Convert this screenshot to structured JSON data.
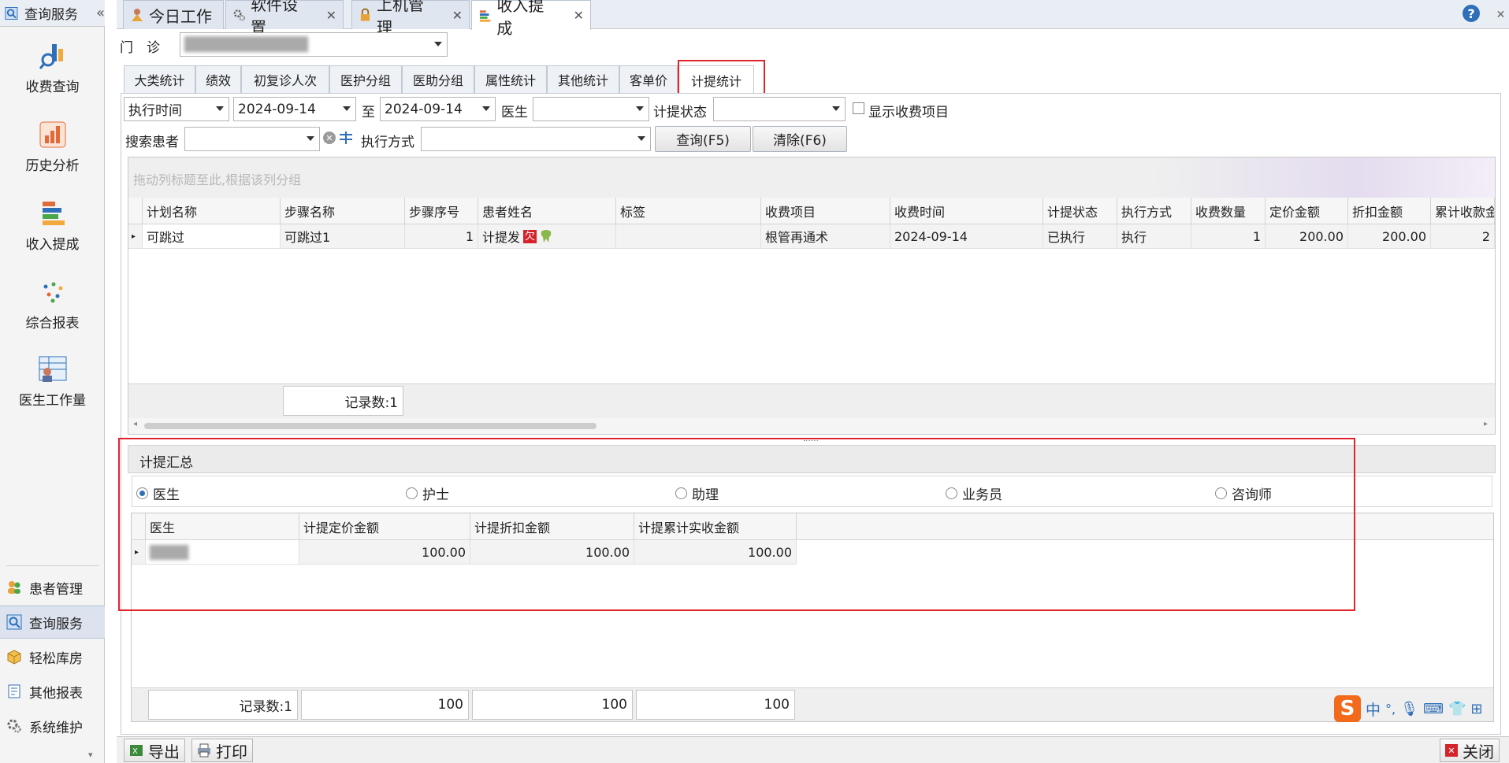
{
  "sidebar": {
    "header_title": "查询服务",
    "big_items": [
      {
        "label": "收费查询",
        "icon": "bar-search-icon"
      },
      {
        "label": "历史分析",
        "icon": "chart-icon"
      },
      {
        "label": "收入提成",
        "icon": "stacked-bars-icon"
      },
      {
        "label": "综合报表",
        "icon": "dots-icon"
      },
      {
        "label": "医生工作量",
        "icon": "doctor-board-icon"
      }
    ],
    "small_items": [
      {
        "label": "患者管理",
        "icon": "users-icon"
      },
      {
        "label": "查询服务",
        "icon": "search-icon"
      },
      {
        "label": "轻松库房",
        "icon": "box-icon"
      },
      {
        "label": "其他报表",
        "icon": "report-icon"
      },
      {
        "label": "系统维护",
        "icon": "gear-icon"
      }
    ]
  },
  "tabs": [
    {
      "label": "今日工作",
      "icon": "person-icon"
    },
    {
      "label": "软件设置",
      "icon": "gear-icon"
    },
    {
      "label": "上机管理",
      "icon": "lock-icon"
    },
    {
      "label": "收入提成",
      "icon": "stacked-bars-icon"
    }
  ],
  "clinic": {
    "label": "门　诊"
  },
  "subtabs": [
    "大类统计",
    "绩效",
    "初复诊人次",
    "医护分组",
    "医助分组",
    "属性统计",
    "其他统计",
    "客单价",
    "计提统计"
  ],
  "filters": {
    "time_type": "执行时间",
    "date_from": "2024-09-14",
    "to_label": "至",
    "date_to": "2024-09-14",
    "doctor_label": "医生",
    "status_label": "计提状态",
    "show_items_label": "显示收费项目",
    "search_patient_label": "搜索患者",
    "exec_method_label": "执行方式",
    "query_btn": "查询(F5)",
    "clear_btn": "清除(F6)"
  },
  "group_hint": "拖动列标题至此,根据该列分组",
  "main_grid": {
    "columns": [
      "计划名称",
      "步骤名称",
      "步骤序号",
      "患者姓名",
      "标签",
      "收费项目",
      "收费时间",
      "计提状态",
      "执行方式",
      "收费数量",
      "定价金额",
      "折扣金额",
      "累计收款金"
    ],
    "rows": [
      [
        "可跳过",
        "可跳过1",
        "1",
        "计提发",
        "",
        "根管再通术",
        "2024-09-14",
        "已执行",
        "执行",
        "1",
        "200.00",
        "200.00",
        "2"
      ]
    ],
    "badge_text": "欠",
    "record_count": "记录数:1"
  },
  "summary": {
    "title": "计提汇总",
    "radios": [
      "医生",
      "护士",
      "助理",
      "业务员",
      "咨询师"
    ],
    "selected": "医生",
    "columns": [
      "医生",
      "计提定价金额",
      "计提折扣金额",
      "计提累计实收金额"
    ],
    "rows": [
      [
        "",
        "100.00",
        "100.00",
        "100.00"
      ]
    ],
    "footer": [
      "记录数:1",
      "100",
      "100",
      "100"
    ]
  },
  "bottom": {
    "export": "导出",
    "print": "打印",
    "close": "关闭"
  },
  "ime": {
    "lang": "中"
  },
  "colors": {
    "highlight": "#e0242b",
    "accent": "#2f6fb8"
  }
}
